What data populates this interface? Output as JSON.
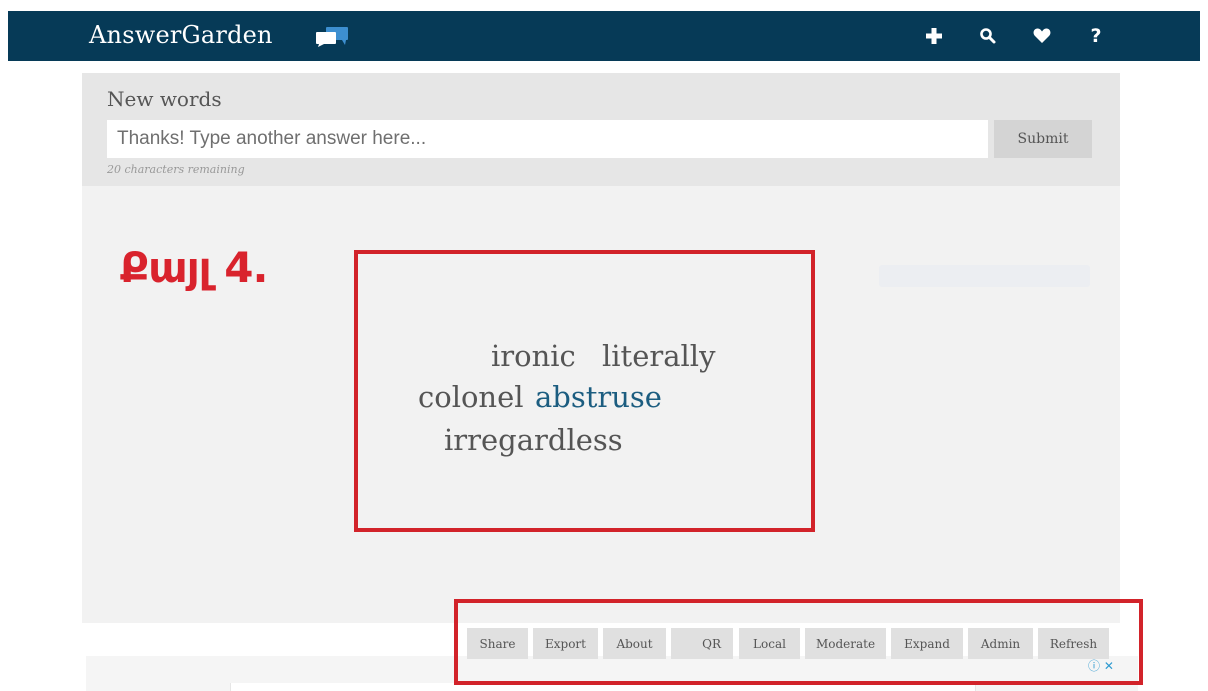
{
  "header": {
    "brand": "AnswerGarden",
    "icons": [
      "plus-icon",
      "search-icon",
      "heart-icon",
      "help-icon"
    ],
    "colors": {
      "background": "#063a57",
      "text": "#ffffff"
    }
  },
  "garden": {
    "question": "New words",
    "input_placeholder": "Thanks! Type another answer here...",
    "submit_label": "Submit",
    "remaining": "20 characters remaining"
  },
  "annotation": {
    "step": "Քայլ 4.",
    "color": "#d2232a"
  },
  "cloud": {
    "words": [
      "ironic",
      "literally",
      "colonel",
      "abstruse",
      "irregardless"
    ],
    "highlight_color": "#1c5d80"
  },
  "toolbar": {
    "buttons": [
      "Share",
      "Export",
      "About",
      "QR",
      "Local",
      "Moderate",
      "Expand",
      "Admin",
      "Refresh"
    ]
  },
  "ad": {
    "marker": "ⓘ ✕"
  }
}
